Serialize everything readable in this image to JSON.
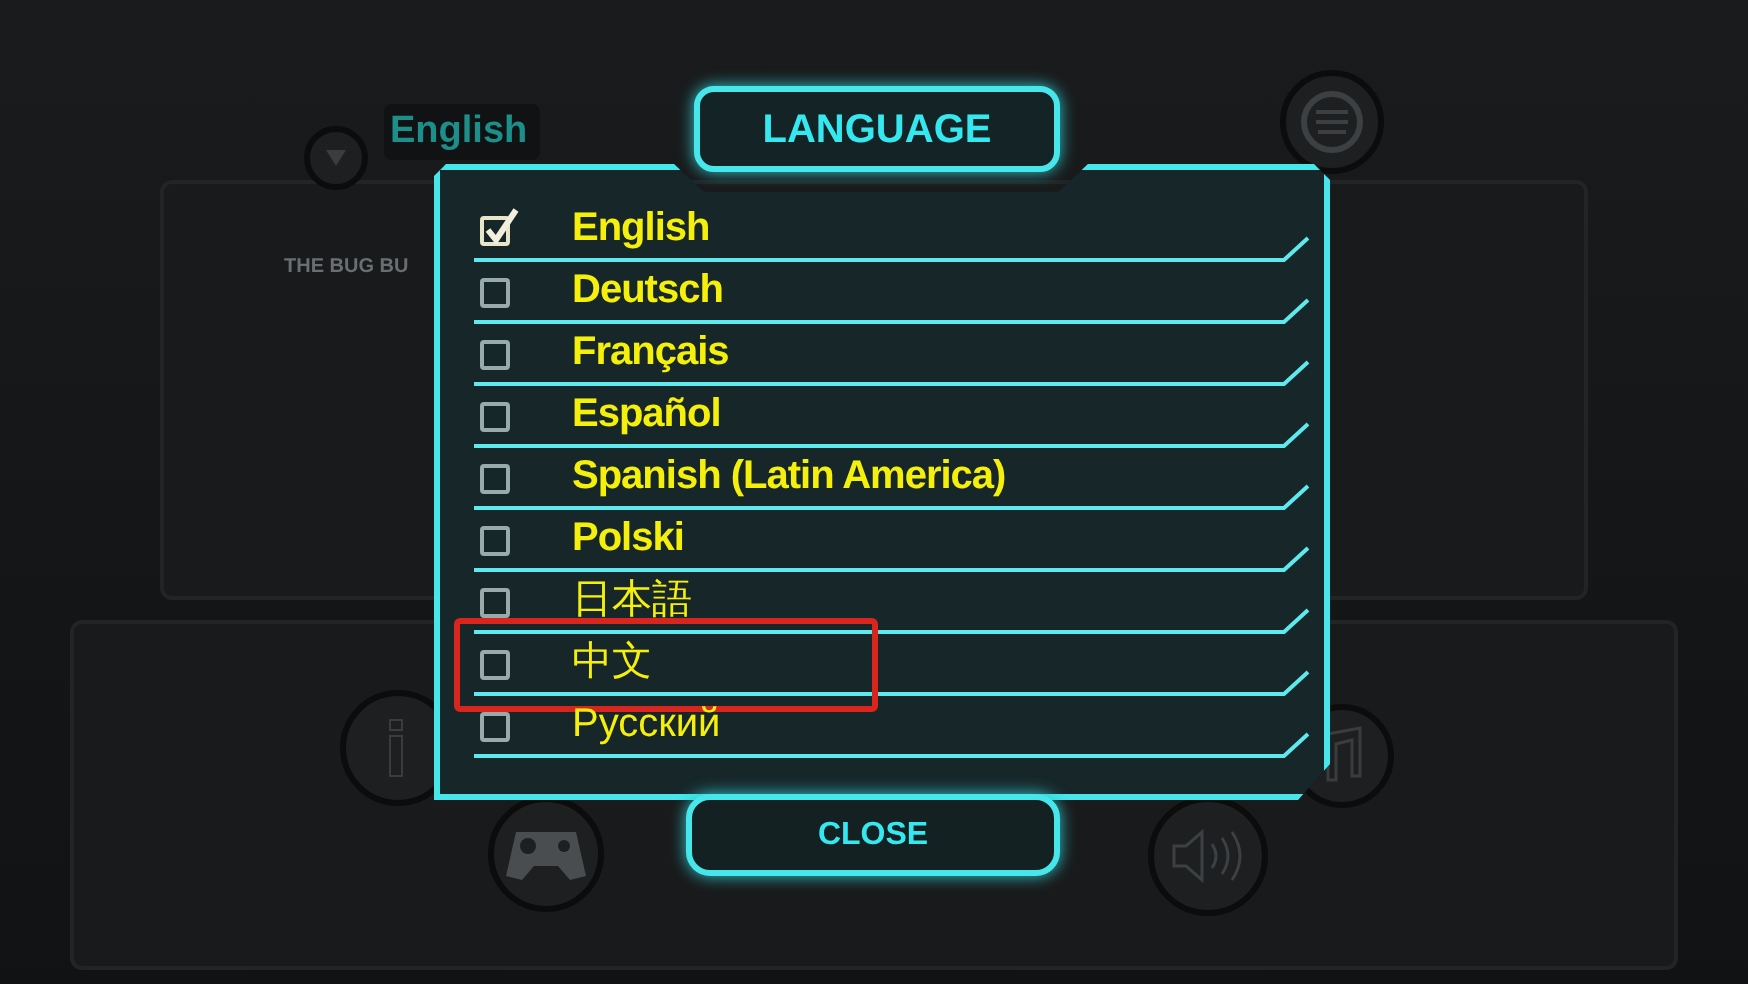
{
  "background": {
    "dropdown_value": "English",
    "caption": "THE BUG BU"
  },
  "dialog": {
    "title": "LANGUAGE",
    "close_button": "CLOSE",
    "languages": [
      {
        "label": "English",
        "kind": "bold",
        "checked": true,
        "highlighted": false
      },
      {
        "label": "Deutsch",
        "kind": "bold",
        "checked": false,
        "highlighted": false
      },
      {
        "label": "Français",
        "kind": "bold",
        "checked": false,
        "highlighted": false
      },
      {
        "label": "Español",
        "kind": "bold",
        "checked": false,
        "highlighted": false
      },
      {
        "label": "Spanish (Latin America)",
        "kind": "bold",
        "checked": false,
        "highlighted": false
      },
      {
        "label": "Polski",
        "kind": "bold",
        "checked": false,
        "highlighted": false
      },
      {
        "label": "日本語",
        "kind": "plain",
        "checked": false,
        "highlighted": false
      },
      {
        "label": "中文",
        "kind": "plain",
        "checked": false,
        "highlighted": true
      },
      {
        "label": "Русский",
        "kind": "plain",
        "checked": false,
        "highlighted": false
      }
    ]
  }
}
